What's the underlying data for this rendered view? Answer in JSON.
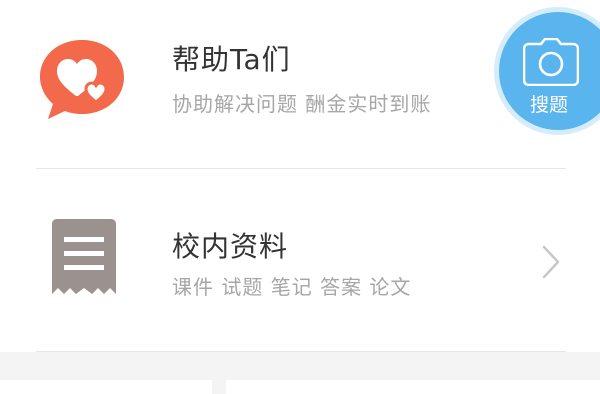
{
  "rows": {
    "help": {
      "title": "帮助Ta们",
      "subtitle": "协助解决问题 酬金实时到账",
      "icon": "heart-bubble-icon"
    },
    "materials": {
      "title": "校内资料",
      "subtitle": "课件 试题 笔记 答案 论文",
      "icon": "receipt-icon"
    }
  },
  "camera_button": {
    "label": "搜题",
    "icon": "camera-icon"
  },
  "colors": {
    "heart_bubble": "#f26a4b",
    "receipt": "#9b918f",
    "fab": "#5ab4ed",
    "fab_halo": "#d4ecfb",
    "title_text": "#333333",
    "subtitle_text": "#a6a6a6",
    "divider": "#e6e6e6",
    "chevron": "#c8c8c8"
  }
}
